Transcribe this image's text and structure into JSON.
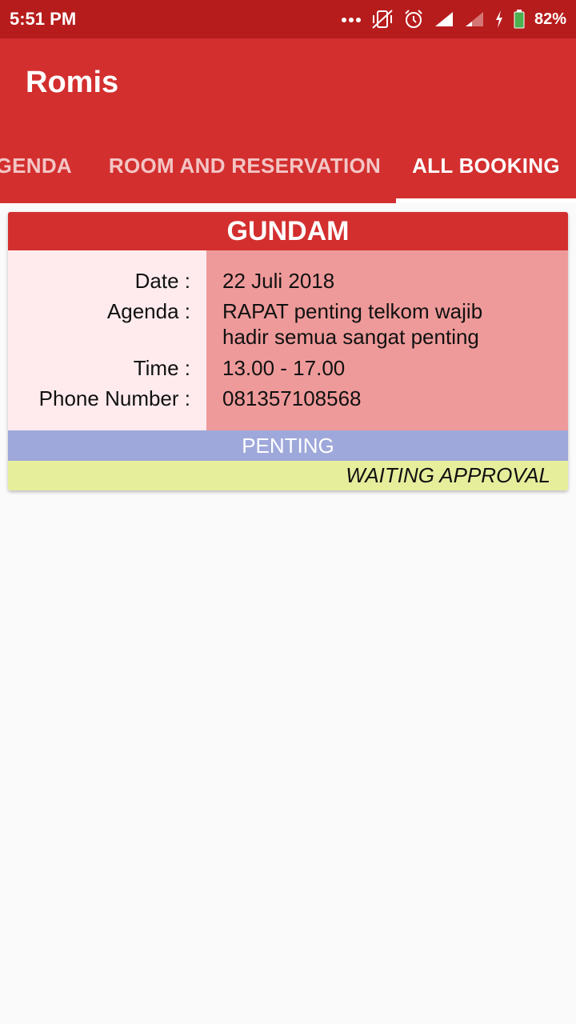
{
  "status_bar": {
    "time": "5:51 PM",
    "battery": "82%",
    "icons": [
      "more-dots-icon",
      "vibrate-off-icon",
      "alarm-icon",
      "signal-icon",
      "signal-weak-icon",
      "charging-icon",
      "battery-icon"
    ]
  },
  "app": {
    "title": "Romis"
  },
  "tabs": [
    {
      "label": "GENDA",
      "active": false
    },
    {
      "label": "ROOM AND RESERVATION",
      "active": false
    },
    {
      "label": "ALL BOOKING",
      "active": true
    }
  ],
  "booking": {
    "room": "GUNDAM",
    "labels": {
      "date": "Date :",
      "agenda": "Agenda :",
      "time": "Time :",
      "phone": "Phone Number :"
    },
    "values": {
      "date": "22 Juli 2018",
      "agenda": "RAPAT penting telkom wajib hadir semua sangat penting",
      "time": "13.00 - 17.00",
      "phone": "081357108568"
    },
    "priority": "PENTING",
    "status": "WAITING APPROVAL"
  },
  "colors": {
    "status_bar": "#b71c1c",
    "primary": "#d32f2f",
    "label_bg": "#ffebee",
    "value_bg": "#ef9a9a",
    "priority_bg": "#9fa8da",
    "status_bg": "#e6ee9c"
  }
}
